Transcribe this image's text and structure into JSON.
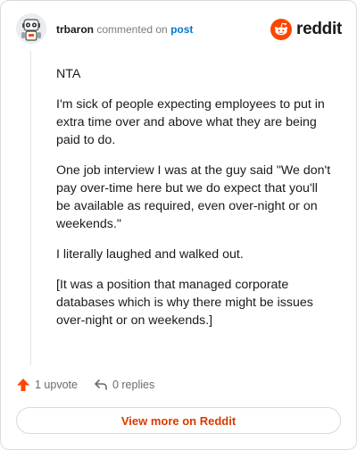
{
  "header": {
    "username": "trbaron",
    "action_text": "commented on",
    "link_text": "post",
    "brand": "reddit"
  },
  "comment": {
    "paragraphs": [
      "NTA",
      "I'm sick of people expecting employees to put in extra time over and above what they are being paid to do.",
      "One job interview I was at the guy said \"We don't pay over-time here but we do expect that you'll be available as required, even over-night or on weekends.\"",
      "I literally laughed and walked out.",
      "[It was a position that managed corporate databases which is why there might be issues over-night or on weekends.]"
    ]
  },
  "actions": {
    "upvote_label": "1 upvote",
    "replies_label": "0 replies"
  },
  "footer": {
    "view_more_label": "View more on Reddit"
  },
  "colors": {
    "brand_orange": "#ff4500",
    "upvote_orange": "#ff4500",
    "link_blue": "#0079d3",
    "view_more_text": "#d93a00"
  },
  "icons": {
    "avatar": "robot-avatar-icon",
    "brand": "reddit-snoo-icon",
    "upvote": "arrow-up-icon",
    "reply": "reply-arrow-icon"
  }
}
